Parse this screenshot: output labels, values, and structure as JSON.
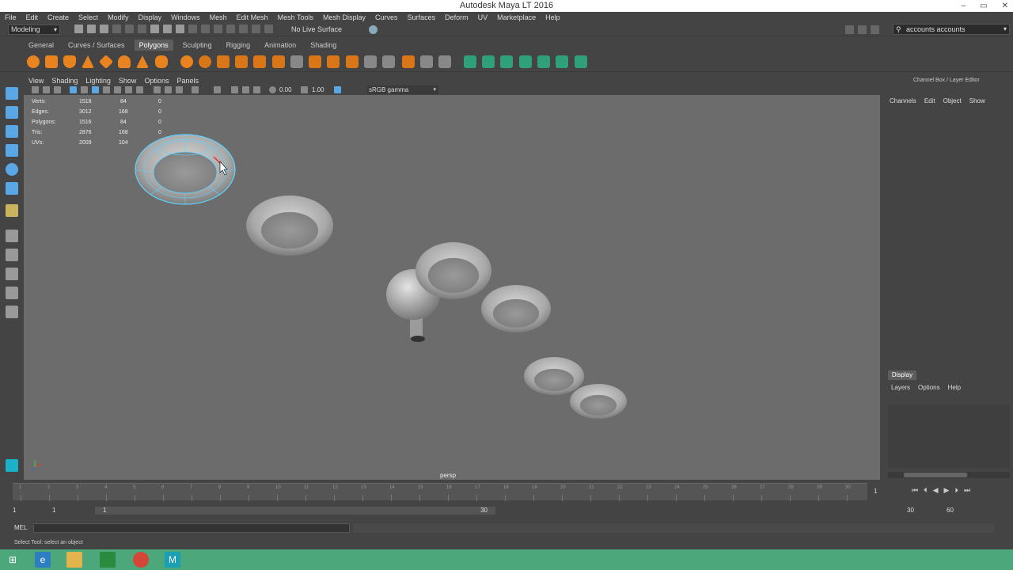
{
  "window": {
    "title": "Autodesk Maya LT 2016",
    "controls": [
      "–",
      "▭",
      "✕"
    ]
  },
  "menubar": {
    "items": [
      "File",
      "Edit",
      "Create",
      "Select",
      "Modify",
      "Display",
      "Windows",
      "Mesh",
      "Edit Mesh",
      "Mesh Tools",
      "Mesh Display",
      "Curves",
      "Surfaces",
      "Deform",
      "UV",
      "Marketplace",
      "Help"
    ]
  },
  "statusline": {
    "mode": "Modeling",
    "live_surface": "No Live Surface",
    "search_value": "accounts accounts"
  },
  "shelf": {
    "tabs": [
      "General",
      "Curves / Surfaces",
      "Polygons",
      "Sculpting",
      "Rigging",
      "Animation",
      "Shading"
    ],
    "active_tab": "Polygons"
  },
  "panel": {
    "menu": [
      "View",
      "Shading",
      "Lighting",
      "Show",
      "Options",
      "Panels"
    ],
    "field_a": "0.00",
    "field_b": "1.00",
    "color_space": "sRGB gamma"
  },
  "hud": {
    "rows": [
      {
        "label": "Verts:",
        "a": "1518",
        "b": "84",
        "c": "0"
      },
      {
        "label": "Edges:",
        "a": "3012",
        "b": "168",
        "c": "0"
      },
      {
        "label": "Polygons:",
        "a": "1516",
        "b": "84",
        "c": "0"
      },
      {
        "label": "Tris:",
        "a": "2876",
        "b": "168",
        "c": "0"
      },
      {
        "label": "UVs:",
        "a": "2009",
        "b": "104",
        "c": "0"
      }
    ]
  },
  "viewport": {
    "camera": "persp"
  },
  "right_panel": {
    "title": "Channel Box / Layer Editor",
    "channel_menu": [
      "Channels",
      "Edit",
      "Object",
      "Show"
    ],
    "display_tab": "Display",
    "layer_menu": [
      "Layers",
      "Options",
      "Help"
    ]
  },
  "timeline": {
    "ticks": [
      "1",
      "2",
      "3",
      "4",
      "5",
      "6",
      "7",
      "8",
      "9",
      "10",
      "11",
      "12",
      "13",
      "14",
      "15",
      "16",
      "17",
      "18",
      "19",
      "20",
      "21",
      "22",
      "23",
      "24",
      "25",
      "26",
      "27",
      "28",
      "29",
      "30"
    ],
    "current_frame": "1"
  },
  "range": {
    "start": "1",
    "start_inner": "1",
    "range_start": "1",
    "range_end": "30",
    "end_inner": "30",
    "end": "60"
  },
  "command": {
    "label": "MEL"
  },
  "help_line": "Select Tool: select an object"
}
